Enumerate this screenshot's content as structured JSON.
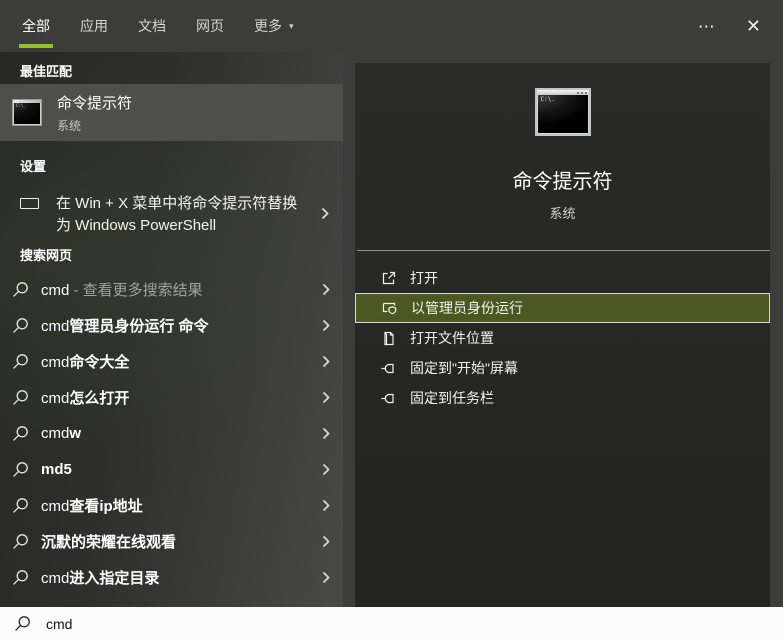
{
  "colors": {
    "accent": "#94c229",
    "admin_bg": "#4c5722",
    "admin_border": "#d8d8d6"
  },
  "icons": {
    "ellipsis": "⋯",
    "close": "✕",
    "dropdown": "▾"
  },
  "header": {
    "tabs": [
      "全部",
      "应用",
      "文档",
      "网页"
    ],
    "more_label": "更多",
    "active_tab": "全部"
  },
  "left": {
    "best_match": {
      "section": "最佳匹配",
      "title": "命令提示符",
      "subtitle": "系统",
      "icon_prompt": "C:\\_"
    },
    "settings": {
      "section": "设置",
      "item": "在 Win + X 菜单中将命令提示符替换为 Windows PowerShell"
    },
    "search_web": {
      "section": "搜索网页",
      "items": [
        {
          "prefix": "cmd",
          "suffix": " - 查看更多搜索结果"
        },
        {
          "prefix": "cmd",
          "suffix": "管理员身份运行 命令"
        },
        {
          "prefix": "cmd",
          "suffix": "命令大全"
        },
        {
          "prefix": "cmd",
          "suffix": "怎么打开"
        },
        {
          "prefix": "cmd",
          "suffix": "w"
        },
        {
          "prefix": "",
          "suffix": "md5"
        },
        {
          "prefix": "cmd",
          "suffix": "查看ip地址"
        },
        {
          "prefix": "",
          "suffix": "沉默的荣耀在线观看"
        },
        {
          "prefix": "cmd",
          "suffix": "进入指定目录"
        }
      ]
    }
  },
  "right": {
    "app_title": "命令提示符",
    "app_subtitle": "系统",
    "icon_prompt": "C:\\.",
    "actions": [
      "打开",
      "以管理员身份运行",
      "打开文件位置",
      "固定到\"开始\"屏幕",
      "固定到任务栏"
    ],
    "highlighted_action": "以管理员身份运行"
  },
  "search_bar": {
    "value": "cmd"
  }
}
